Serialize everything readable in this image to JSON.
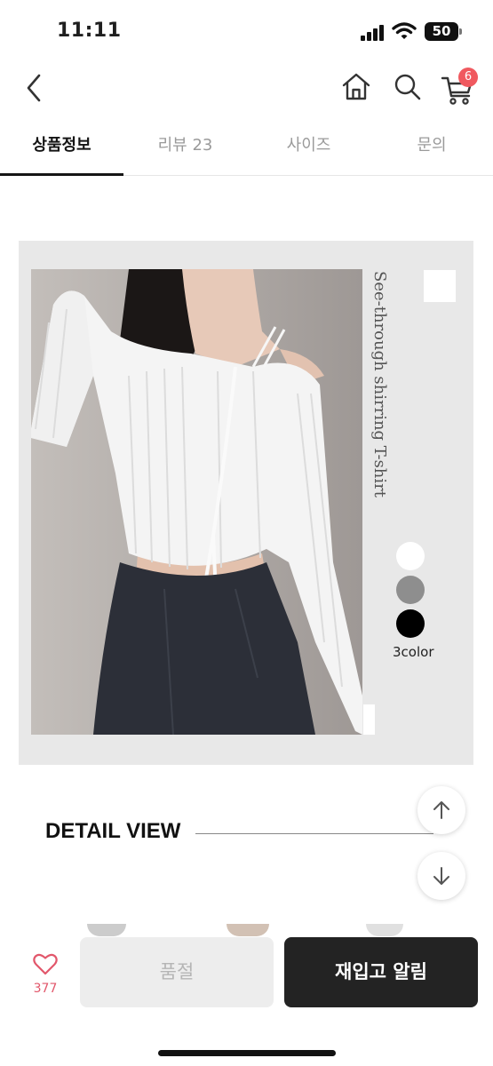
{
  "status_bar": {
    "time": "11:11",
    "battery": "50"
  },
  "header": {
    "cart_count": "6"
  },
  "tabs": [
    {
      "label": "상품정보",
      "active": true
    },
    {
      "label": "리뷰 23",
      "active": false
    },
    {
      "label": "사이즈",
      "active": false
    },
    {
      "label": "문의",
      "active": false
    }
  ],
  "product": {
    "caption": "See-through shirring T-shirt",
    "color_options": [
      "#ffffff",
      "#8e8e8e",
      "#000000"
    ],
    "color_label": "3color"
  },
  "detail": {
    "title": "DETAIL VIEW"
  },
  "bottom_bar": {
    "like_count": "377",
    "soldout_label": "품절",
    "restock_label": "재입고 알림"
  },
  "colors": {
    "accent": "#f0595f",
    "heart": "#e2576b",
    "dark_button": "#232323",
    "panel": "#e8e8e8"
  },
  "icons": [
    "back-chevron-icon",
    "home-icon",
    "search-icon",
    "cart-icon",
    "heart-icon",
    "arrow-up-icon",
    "arrow-down-icon"
  ]
}
